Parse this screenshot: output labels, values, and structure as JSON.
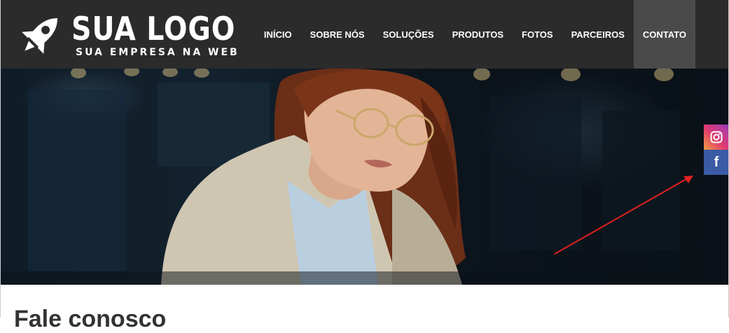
{
  "header": {
    "logo": {
      "icon": "rocket-icon",
      "title": "SUA LOGO",
      "tagline": "SUA EMPRESA NA WEB"
    },
    "nav": [
      {
        "label": "INÍCIO",
        "active": false
      },
      {
        "label": "SOBRE NÓS",
        "active": false
      },
      {
        "label": "SOLUÇÕES",
        "active": false
      },
      {
        "label": "PRODUTOS",
        "active": false
      },
      {
        "label": "FOTOS",
        "active": false
      },
      {
        "label": "PARCEIROS",
        "active": false
      },
      {
        "label": "CONTATO",
        "active": true
      }
    ],
    "colors": {
      "background": "#2b2b2b",
      "active_item": "#4a4a4a"
    }
  },
  "hero": {
    "image": "woman-with-glasses-at-desk-photo"
  },
  "social": {
    "instagram": {
      "icon": "instagram-icon",
      "color": "#e23b6f"
    },
    "facebook": {
      "icon": "facebook-icon",
      "glyph": "f",
      "color": "#3b5ba5"
    }
  },
  "annotation": {
    "icon": "red-arrow-icon",
    "color": "#e02020"
  },
  "content": {
    "heading": "Fale conosco"
  }
}
